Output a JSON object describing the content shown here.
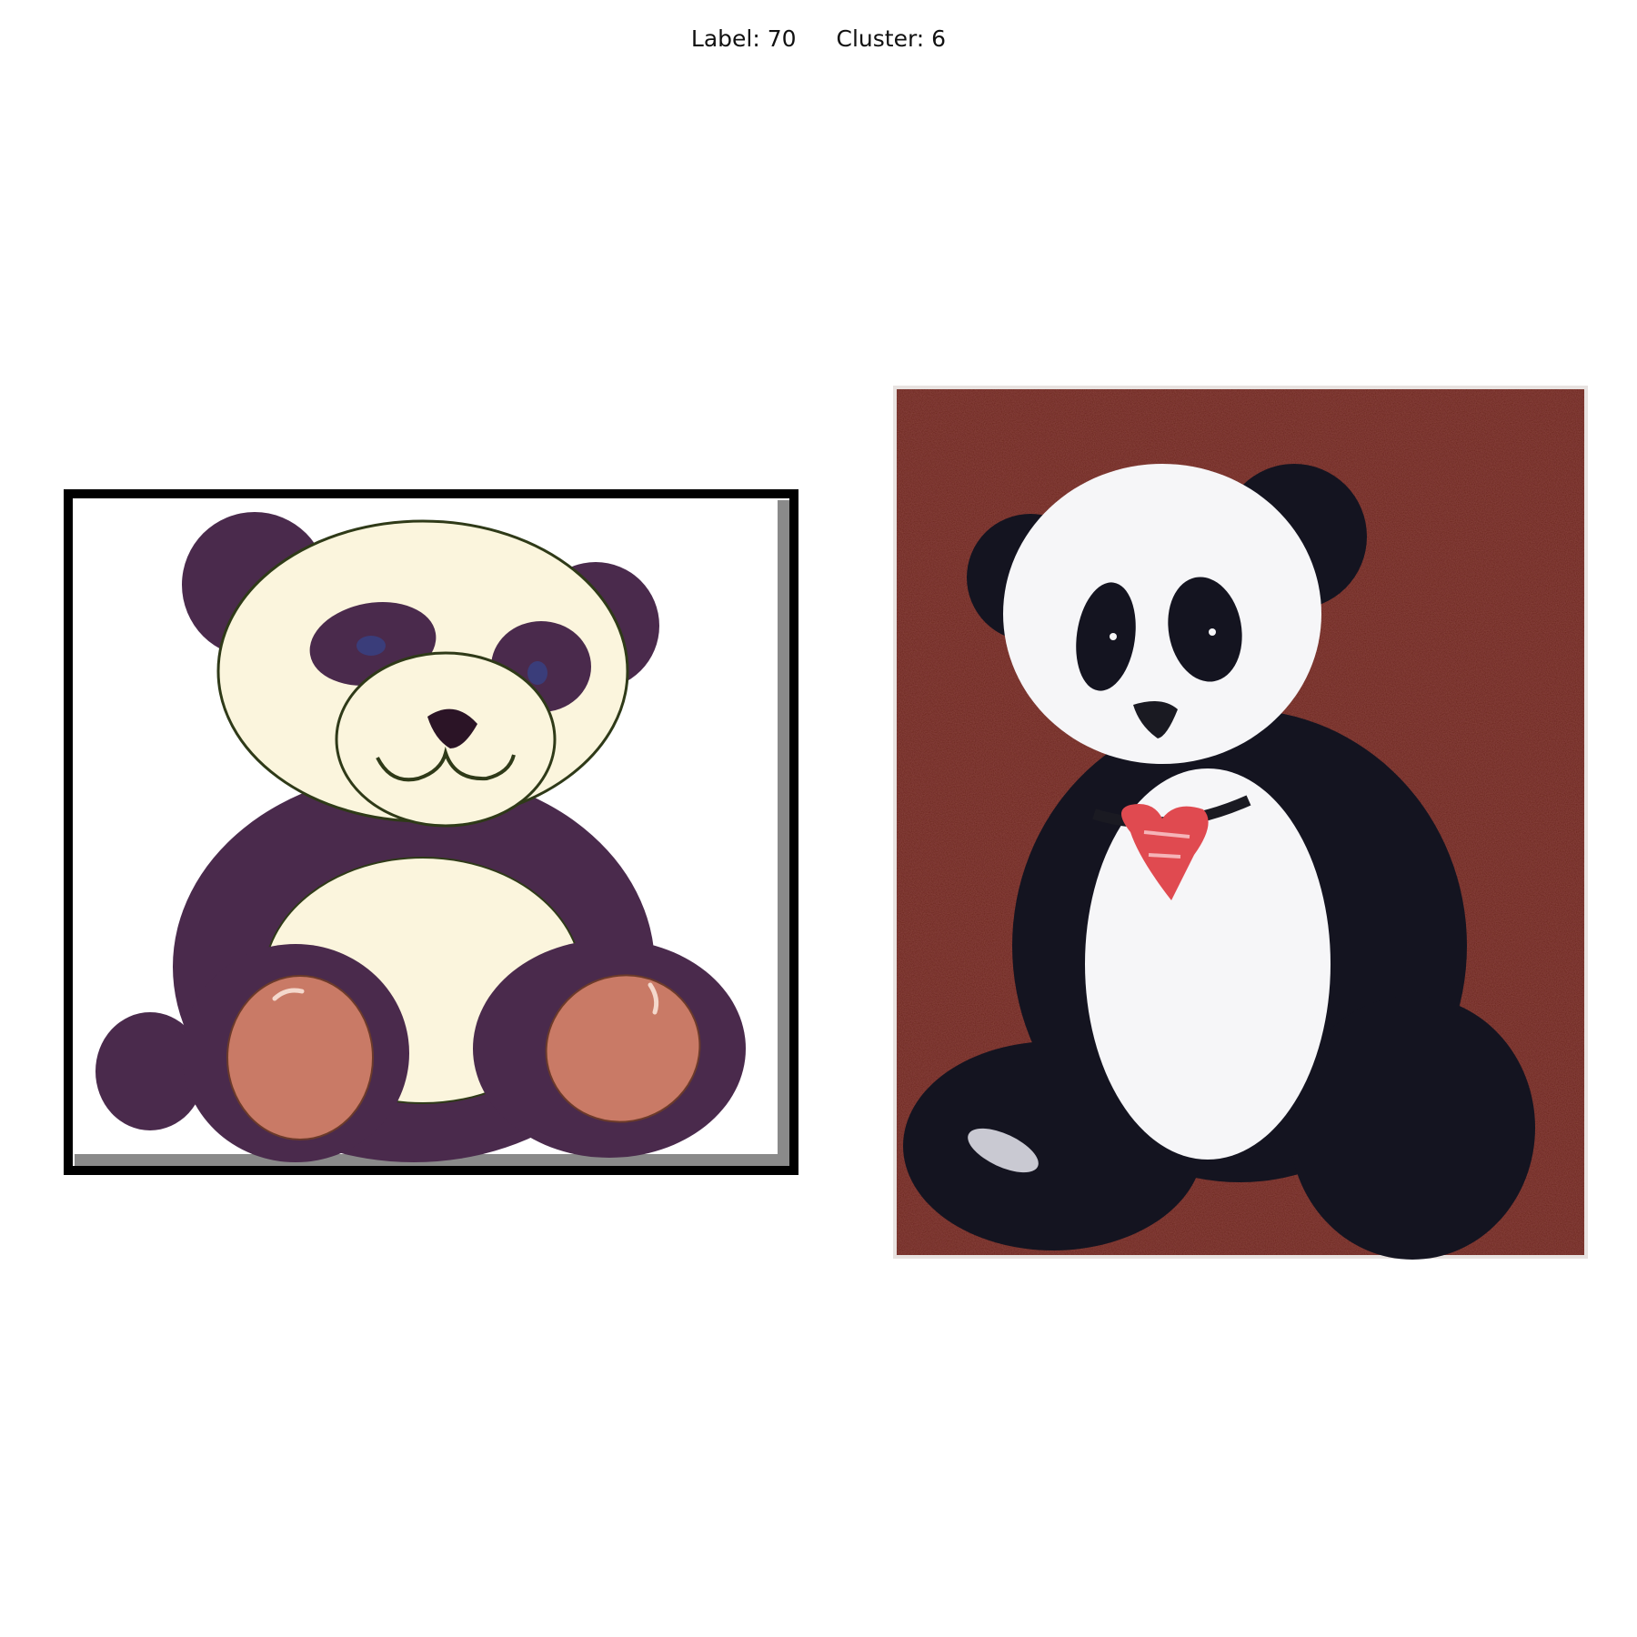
{
  "header": {
    "label_text": "Label: 70",
    "cluster_text": "Cluster: 6"
  },
  "images": [
    {
      "name": "cartoon-panda-plush",
      "colors": {
        "fur": "#4a2a4c",
        "face": "#fbf5dd",
        "paws": "#c97a66",
        "frame": "#000000"
      }
    },
    {
      "name": "photo-panda-plush",
      "colors": {
        "background": "#6a211d",
        "fur": "#141420",
        "face": "#f6f6f8",
        "heart": "#e04a50"
      }
    }
  ]
}
